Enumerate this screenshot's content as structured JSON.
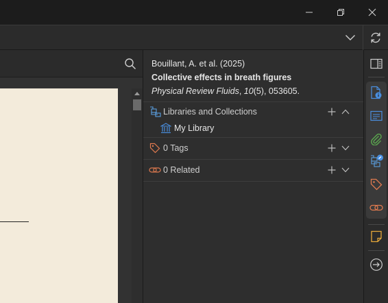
{
  "window": {
    "controls": [
      "minimize-icon",
      "restore-icon",
      "close-icon"
    ]
  },
  "tabbar": {
    "icons": [
      "chevron-down-icon",
      "sync-icon"
    ]
  },
  "reader": {
    "icons": [
      "search-icon",
      "scroll-up-icon"
    ]
  },
  "item": {
    "citation": "Bouillant, A. et al. (2025)",
    "title": "Collective effects in breath figures",
    "journal": "Physical Review Fluids",
    "volume": "10",
    "issue_pages": "(5), 053605."
  },
  "sections": {
    "libraries": {
      "label": "Libraries and Collections",
      "icon": "libraries-collections-icon",
      "expanded": true
    },
    "library_item": {
      "label": "My Library",
      "icon": "library-icon"
    },
    "tags": {
      "label": "0 Tags",
      "icon": "tag-icon",
      "expanded": false
    },
    "related": {
      "label": "0 Related",
      "icon": "related-link-icon",
      "expanded": false
    }
  },
  "sidenav": {
    "icons": [
      "context-pane-toggle-icon",
      "info-icon",
      "abstract-icon",
      "attachments-icon",
      "libraries-collections-icon",
      "tags-icon",
      "related-icon",
      "notes-icon",
      "locate-icon"
    ]
  },
  "colors": {
    "background": "#2e2e2e",
    "accent_blue": "#4a8fe0",
    "tag_orange": "#e07a4f",
    "attachment_green": "#5aa84e",
    "note_yellow": "#e8a93a",
    "page": "#f3ebdb"
  }
}
